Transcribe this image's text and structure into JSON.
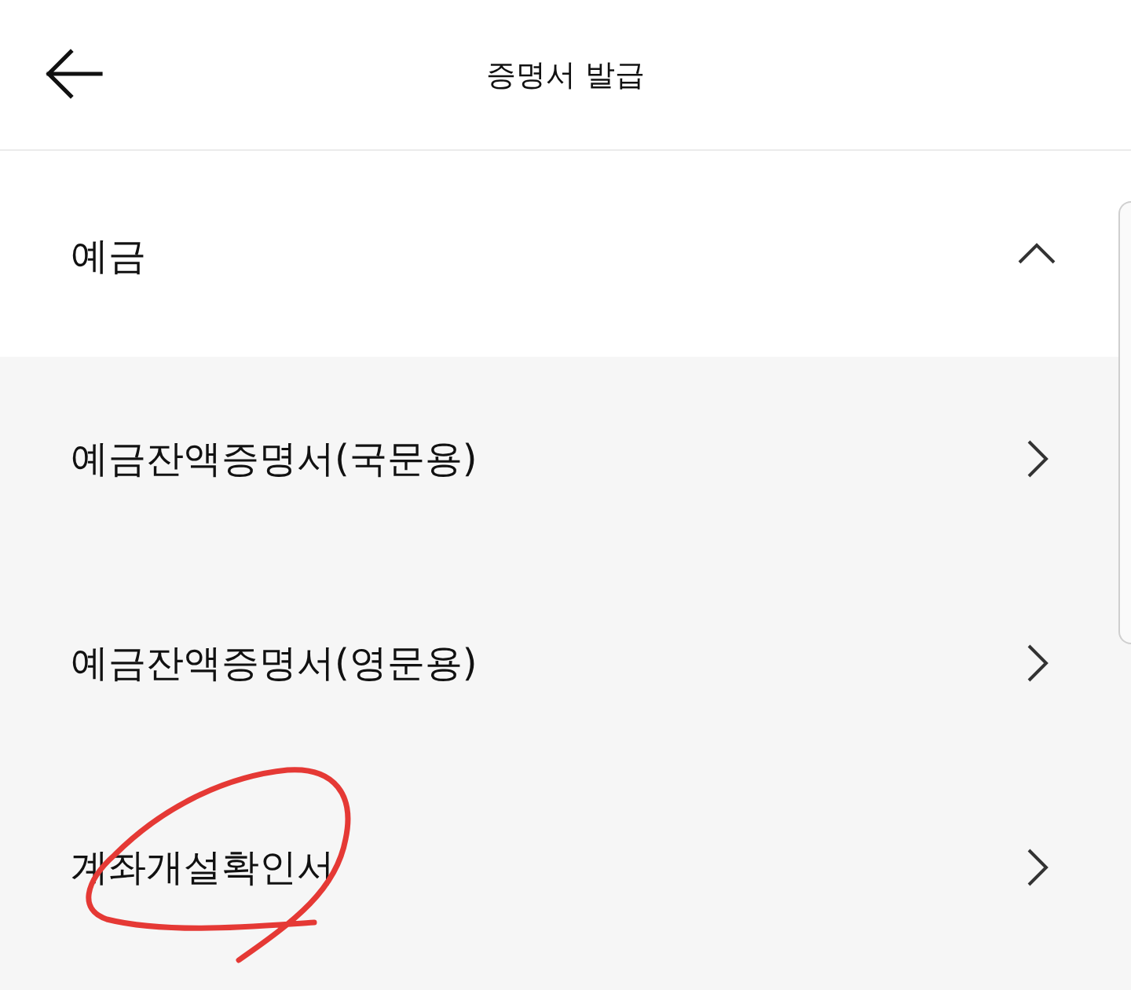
{
  "header": {
    "title": "증명서 발급"
  },
  "sections": [
    {
      "title": "예금",
      "expanded": true,
      "items": [
        {
          "label": "예금잔액증명서(국문용)",
          "circled": false
        },
        {
          "label": "예금잔액증명서(영문용)",
          "circled": false
        },
        {
          "label": "계좌개설확인서",
          "circled": true
        }
      ]
    }
  ]
}
